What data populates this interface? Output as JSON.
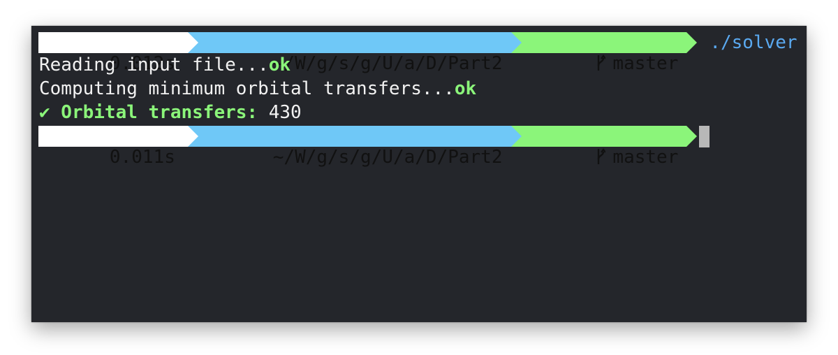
{
  "prompts": [
    {
      "time": "0.012s",
      "path": "~/W/g/s/g/U/a/D/Part2",
      "branch": "master",
      "command": "./solver"
    },
    {
      "time": "0.011s",
      "path": "~/W/g/s/g/U/a/D/Part2",
      "branch": "master",
      "command": ""
    }
  ],
  "output": {
    "reading": "Reading input file...",
    "reading_status": "ok",
    "computing": "Computing minimum orbital transfers...",
    "computing_status": "ok",
    "result_label": "✔ Orbital transfers:",
    "result_value": " 430"
  },
  "colors": {
    "background": "#24262b",
    "time_segment": "#ffffff",
    "path_segment": "#6fc8f7",
    "git_segment": "#8bf57a",
    "command_text": "#5aa9f0",
    "ok_text": "#8bf57a",
    "cursor": "#b8b8b8"
  },
  "icons": {
    "branch": "git-branch-icon"
  }
}
